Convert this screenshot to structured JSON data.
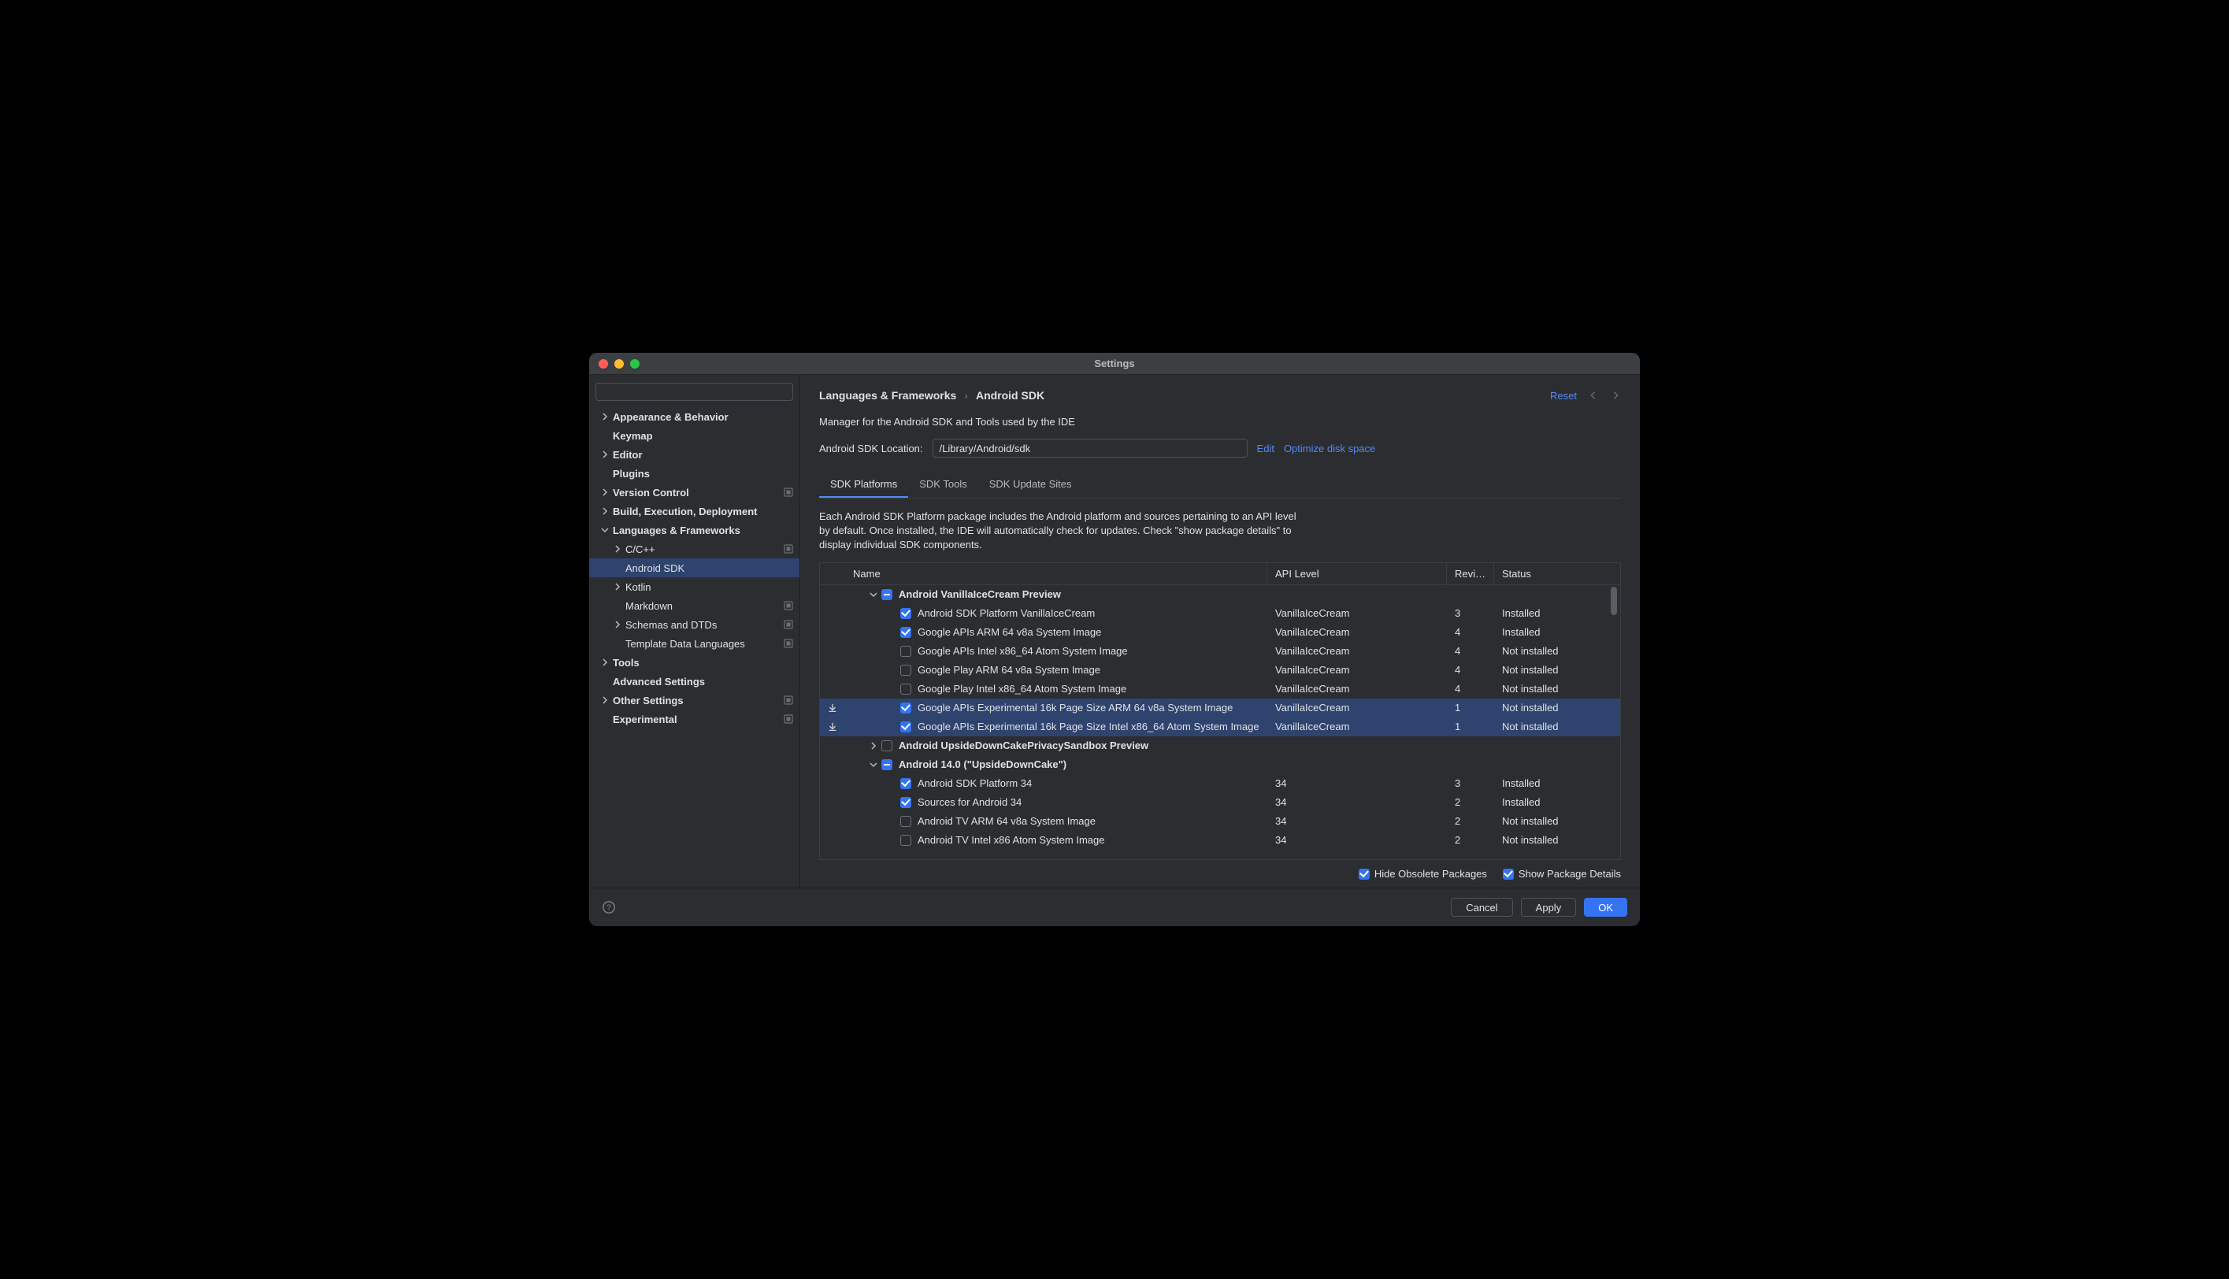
{
  "title": "Settings",
  "search_placeholder": "",
  "sidebar": [
    {
      "label": "Appearance & Behavior",
      "level": 0,
      "chev": "right",
      "bold": true
    },
    {
      "label": "Keymap",
      "level": 0,
      "bold": true
    },
    {
      "label": "Editor",
      "level": 0,
      "chev": "right",
      "bold": true
    },
    {
      "label": "Plugins",
      "level": 0,
      "bold": true
    },
    {
      "label": "Version Control",
      "level": 0,
      "chev": "right",
      "bold": true,
      "mod": true
    },
    {
      "label": "Build, Execution, Deployment",
      "level": 0,
      "chev": "right",
      "bold": true
    },
    {
      "label": "Languages & Frameworks",
      "level": 0,
      "chev": "down",
      "bold": true
    },
    {
      "label": "C/C++",
      "level": 1,
      "chev": "right",
      "mod": true
    },
    {
      "label": "Android SDK",
      "level": 1,
      "sel": true
    },
    {
      "label": "Kotlin",
      "level": 1,
      "chev": "right"
    },
    {
      "label": "Markdown",
      "level": 1,
      "mod": true
    },
    {
      "label": "Schemas and DTDs",
      "level": 1,
      "chev": "right",
      "mod": true
    },
    {
      "label": "Template Data Languages",
      "level": 1,
      "mod": true
    },
    {
      "label": "Tools",
      "level": 0,
      "chev": "right",
      "bold": true
    },
    {
      "label": "Advanced Settings",
      "level": 0,
      "bold": true
    },
    {
      "label": "Other Settings",
      "level": 0,
      "chev": "right",
      "bold": true,
      "mod": true
    },
    {
      "label": "Experimental",
      "level": 0,
      "bold": true,
      "mod": true
    }
  ],
  "breadcrumb": [
    "Languages & Frameworks",
    "Android SDK"
  ],
  "reset_label": "Reset",
  "manager_desc": "Manager for the Android SDK and Tools used by the IDE",
  "sdk_loc_label": "Android SDK Location:",
  "sdk_loc_value": "/Library/Android/sdk",
  "edit_label": "Edit",
  "optimize_label": "Optimize disk space",
  "tabs": [
    "SDK Platforms",
    "SDK Tools",
    "SDK Update Sites"
  ],
  "tab_active": 0,
  "tab_desc": "Each Android SDK Platform package includes the Android platform and sources pertaining to an API level by default. Once installed, the IDE will automatically check for updates. Check \"show package details\" to display individual SDK components.",
  "headers": {
    "name": "Name",
    "api": "API Level",
    "rev": "Revi…",
    "status": "Status"
  },
  "rows": [
    {
      "type": "group",
      "chk": "mix",
      "indent": 0,
      "exp": "down",
      "name": "Android VanillaIceCream Preview",
      "bold": true
    },
    {
      "type": "item",
      "chk": "on",
      "indent": 1,
      "name": "Android SDK Platform VanillaIceCream",
      "api": "VanillaIceCream",
      "rev": "3",
      "status": "Installed"
    },
    {
      "type": "item",
      "chk": "on",
      "indent": 1,
      "name": "Google APIs ARM 64 v8a System Image",
      "api": "VanillaIceCream",
      "rev": "4",
      "status": "Installed"
    },
    {
      "type": "item",
      "chk": "off",
      "indent": 1,
      "name": "Google APIs Intel x86_64 Atom System Image",
      "api": "VanillaIceCream",
      "rev": "4",
      "status": "Not installed"
    },
    {
      "type": "item",
      "chk": "off",
      "indent": 1,
      "name": "Google Play ARM 64 v8a System Image",
      "api": "VanillaIceCream",
      "rev": "4",
      "status": "Not installed"
    },
    {
      "type": "item",
      "chk": "off",
      "indent": 1,
      "name": "Google Play Intel x86_64 Atom System Image",
      "api": "VanillaIceCream",
      "rev": "4",
      "status": "Not installed"
    },
    {
      "type": "item",
      "chk": "on",
      "indent": 1,
      "name": "Google APIs Experimental 16k Page Size ARM 64 v8a System Image",
      "api": "VanillaIceCream",
      "rev": "1",
      "status": "Not installed",
      "sel": true,
      "dl": true
    },
    {
      "type": "item",
      "chk": "on",
      "indent": 1,
      "name": "Google APIs Experimental 16k Page Size Intel x86_64 Atom System Image",
      "api": "VanillaIceCream",
      "rev": "1",
      "status": "Not installed",
      "sel": true,
      "dl": true
    },
    {
      "type": "group",
      "chk": "off",
      "indent": 0,
      "exp": "right",
      "name": "Android UpsideDownCakePrivacySandbox Preview",
      "bold": true
    },
    {
      "type": "group",
      "chk": "mix",
      "indent": 0,
      "exp": "down",
      "name": "Android 14.0 (\"UpsideDownCake\")",
      "bold": true
    },
    {
      "type": "item",
      "chk": "on",
      "indent": 1,
      "name": "Android SDK Platform 34",
      "api": "34",
      "rev": "3",
      "status": "Installed"
    },
    {
      "type": "item",
      "chk": "on",
      "indent": 1,
      "name": "Sources for Android 34",
      "api": "34",
      "rev": "2",
      "status": "Installed"
    },
    {
      "type": "item",
      "chk": "off",
      "indent": 1,
      "name": "Android TV ARM 64 v8a System Image",
      "api": "34",
      "rev": "2",
      "status": "Not installed"
    },
    {
      "type": "item",
      "chk": "off",
      "indent": 1,
      "name": "Android TV Intel x86 Atom System Image",
      "api": "34",
      "rev": "2",
      "status": "Not installed"
    }
  ],
  "hide_obsolete_label": "Hide Obsolete Packages",
  "show_details_label": "Show Package Details",
  "cancel_label": "Cancel",
  "apply_label": "Apply",
  "ok_label": "OK"
}
